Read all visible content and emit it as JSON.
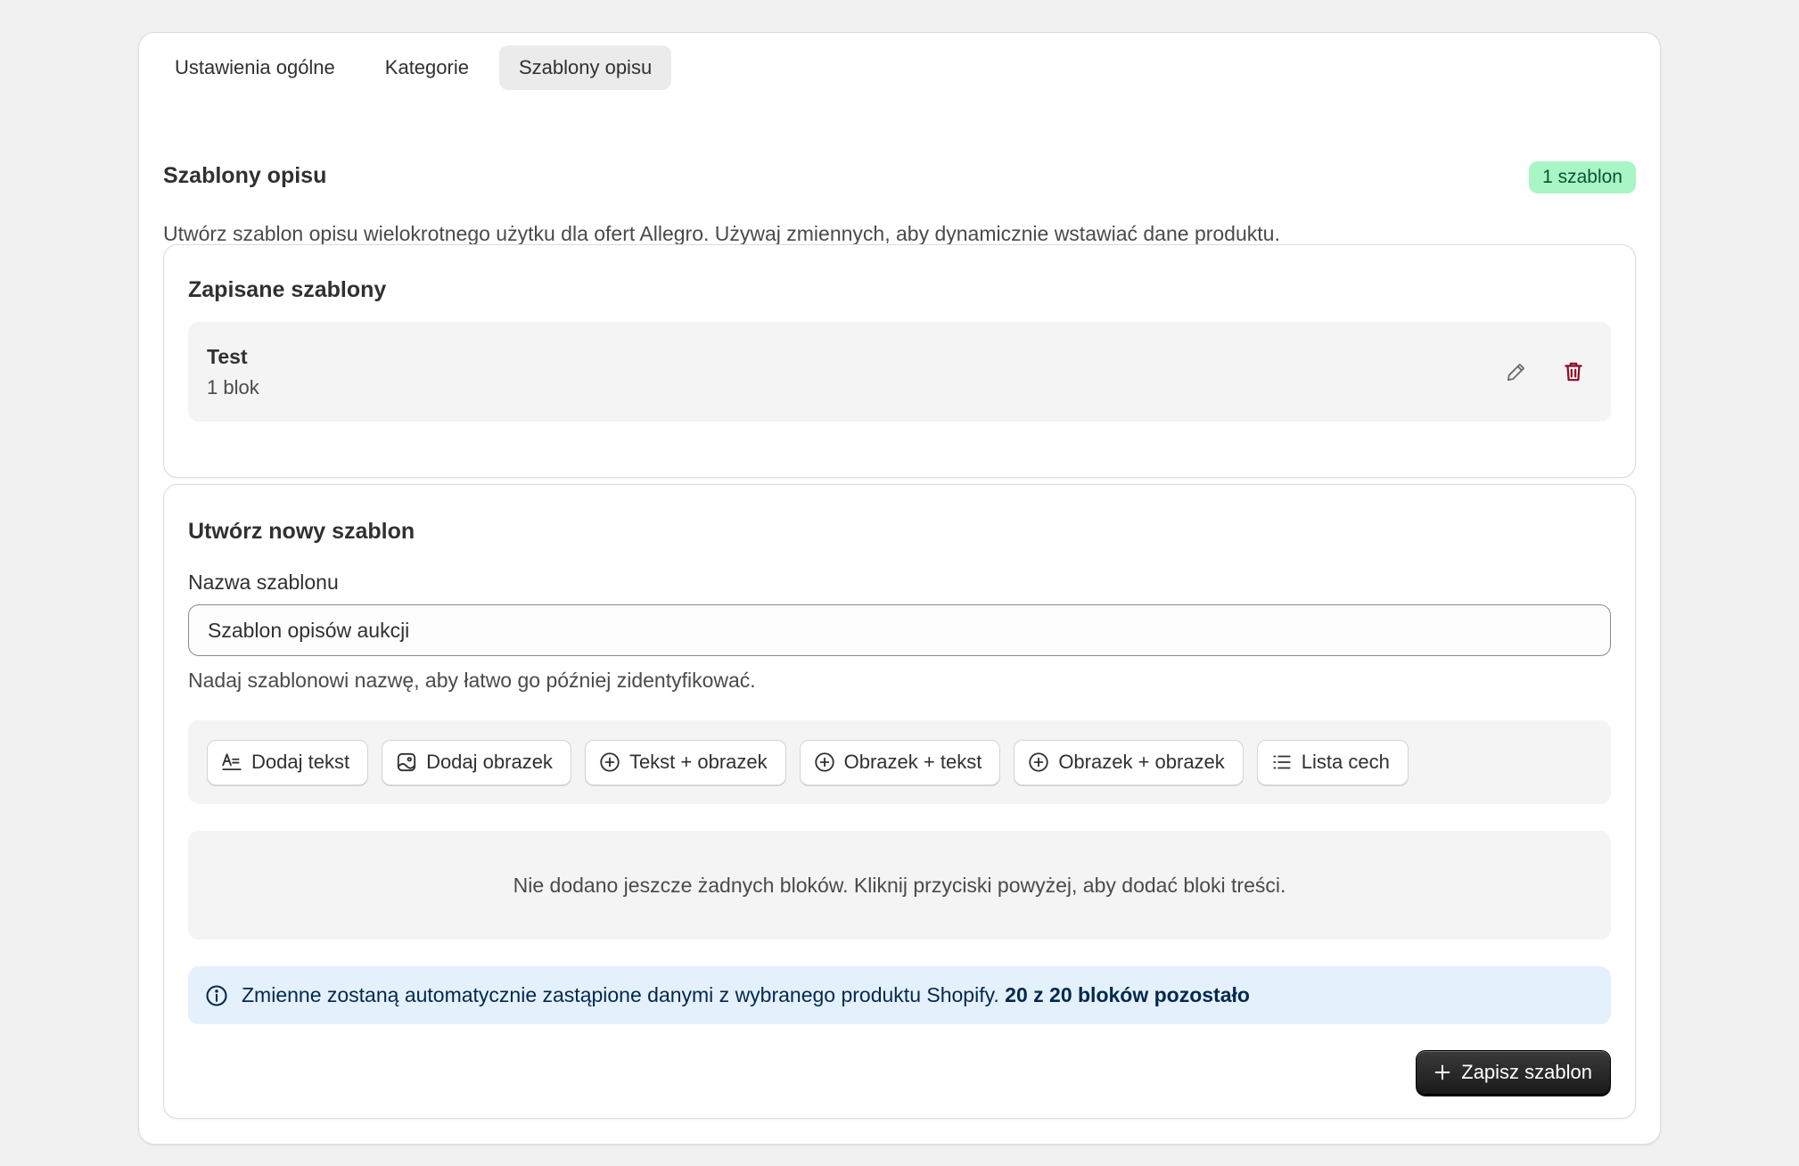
{
  "tabs": [
    {
      "label": "Ustawienia ogólne",
      "active": false
    },
    {
      "label": "Kategorie",
      "active": false
    },
    {
      "label": "Szablony opisu",
      "active": true
    }
  ],
  "section": {
    "title": "Szablony opisu",
    "badge": "1 szablon",
    "badge_color": "#a8f5c6",
    "description": "Utwórz szablon opisu wielokrotnego użytku dla ofert Allegro. Używaj zmiennych, aby dynamicznie wstawiać dane produktu."
  },
  "saved_templates": {
    "title": "Zapisane szablony",
    "items": [
      {
        "name": "Test",
        "meta": "1 blok",
        "edit_icon": "pencil-icon",
        "delete_icon": "trash-icon"
      }
    ]
  },
  "create_template": {
    "title": "Utwórz nowy szablon",
    "name_label": "Nazwa szablonu",
    "name_value": "Szablon opisów aukcji",
    "help_text": "Nadaj szablonowi nazwę, aby łatwo go później zidentyfikować.",
    "buttons": [
      {
        "label": "Dodaj tekst",
        "icon": "text-format-icon"
      },
      {
        "label": "Dodaj obrazek",
        "icon": "image-icon"
      },
      {
        "label": "Tekst + obrazek",
        "icon": "plus-circle-icon"
      },
      {
        "label": "Obrazek + tekst",
        "icon": "plus-circle-icon"
      },
      {
        "label": "Obrazek + obrazek",
        "icon": "plus-circle-icon"
      },
      {
        "label": "Lista cech",
        "icon": "list-icon"
      }
    ],
    "empty_state": "Nie dodano jeszcze żadnych bloków. Kliknij przyciski powyżej, aby dodać bloki treści.",
    "info_text": "Zmienne zostaną automatycznie zastąpione danymi z wybranego produktu Shopify.",
    "info_bold": "20 z 20 bloków pozostało",
    "save_label": "Zapisz szablon"
  },
  "colors": {
    "delete": "#8e0b21",
    "info_bg": "#e5f0fd",
    "primary_button": "#303030"
  }
}
